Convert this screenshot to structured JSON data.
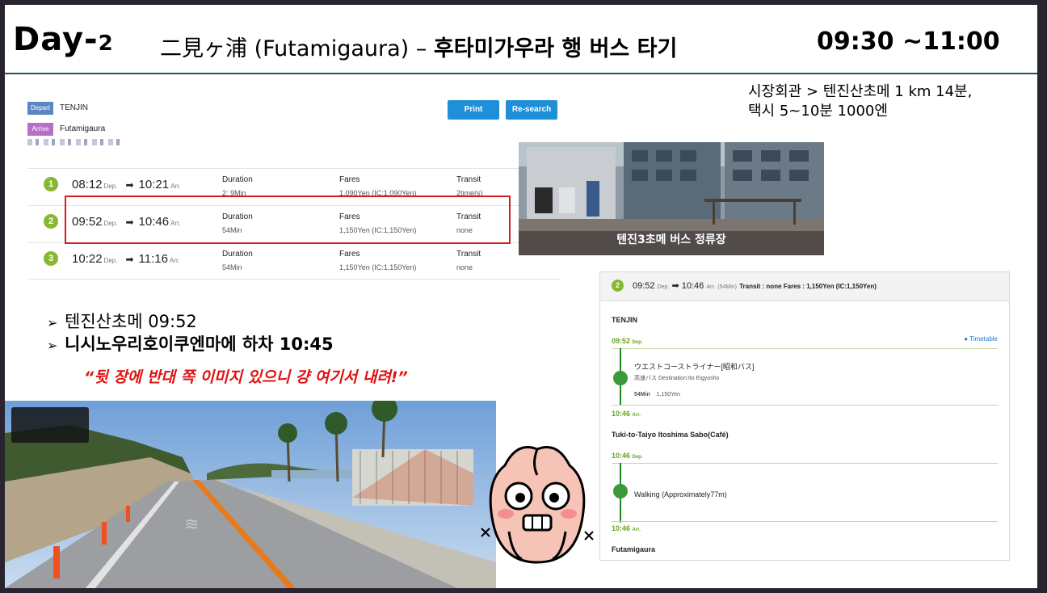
{
  "header": {
    "day_word": "Day-",
    "day_num": "2",
    "place_jp": "二見ヶ浦",
    "place_romaji": "(Futamigaura)",
    "dash": "–",
    "place_kr": "후타미가우라 행 버스 타기",
    "time_range": "09:30 ~11:00"
  },
  "search": {
    "depart_tag": "Depart",
    "depart_name": "TENJIN",
    "arrive_tag": "Arrive",
    "arrive_name": "Futamigaura",
    "print_label": "Print",
    "research_label": "Re-search",
    "col_duration": "Duration",
    "col_fares": "Fares",
    "col_transit": "Transit",
    "dep_abbr": "Dep.",
    "arr_abbr": "Arr.",
    "arrow": "➡",
    "routes": [
      {
        "num": "1",
        "dep": "08:12",
        "arr": "10:21",
        "duration": "2: 9Min",
        "fares": "1,090Yen (IC:1,090Yen)",
        "transit": "2time(s)"
      },
      {
        "num": "2",
        "dep": "09:52",
        "arr": "10:46",
        "duration": "54Min",
        "fares": "1,150Yen (IC:1,150Yen)",
        "transit": "none"
      },
      {
        "num": "3",
        "dep": "10:22",
        "arr": "11:16",
        "duration": "54Min",
        "fares": "1,150Yen (IC:1,150Yen)",
        "transit": "none"
      }
    ]
  },
  "notes": {
    "line1": "시장회관 > 텐진산초메 1 km 14분,",
    "line2": "택시 5~10분 1000엔"
  },
  "bus_photo": {
    "caption": "텐진3초메 버스 정류장"
  },
  "bullets": {
    "arrowhead": "➢",
    "item1": "텐진산초메 09:52",
    "item2": "니시노우리호이쿠엔마에 하차 10:45"
  },
  "quote": "“뒷 장에 반대 쪽 이미지 있으니 걍 여기서 내려!”",
  "detail": {
    "num": "2",
    "dep_time": "09:52",
    "arr_time": "10:46",
    "dep_abbr": "Dep.",
    "arr_abbr": "Arr.",
    "arrow": "➡",
    "duration": "(54Min)",
    "meta": "Transit : none   Fares : 1,150Yen (IC:1,150Yen)",
    "station_start": "TENJIN",
    "time_dep1": "09:52",
    "timetable": "Timetable",
    "bus_name": "ウエストコーストライナー[昭和バス]",
    "bus_sub": "高速バス   Destination:Ito Eigyosho",
    "bus_duration": "54Min",
    "bus_fare": "1,150Yen",
    "time_arr1": "10:46",
    "station_mid": "Tuki-to-Taiyo Itoshima Sabo(Café)",
    "time_dep2": "10:46",
    "walking": "Walking (Approximately77m)",
    "time_arr2": "10:46",
    "station_end": "Futamigaura"
  },
  "colors": {
    "route_green": "#86b831",
    "highlight_red": "#d02020",
    "button_blue": "#1f8fd8",
    "quote_red": "#e01010",
    "title_line": "#1f4f6a"
  }
}
